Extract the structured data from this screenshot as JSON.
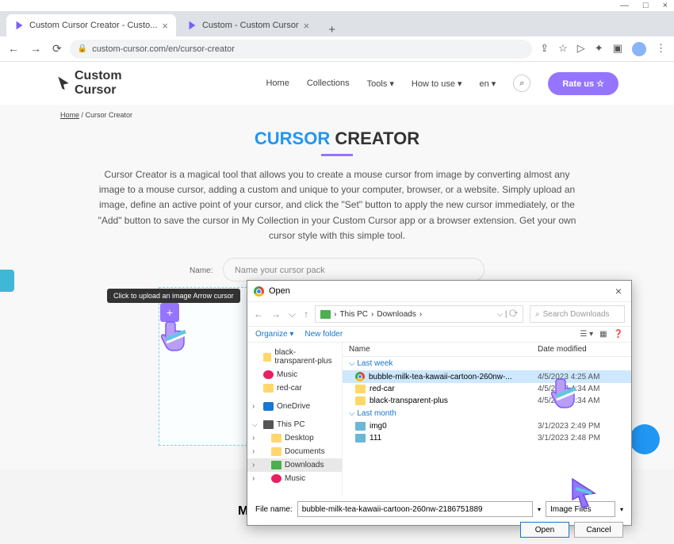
{
  "window": {
    "minimize": "—",
    "maximize": "□",
    "close": "×"
  },
  "tabs": [
    {
      "title": "Custom Cursor Creator - Custo...",
      "active": true
    },
    {
      "title": "Custom - Custom Cursor",
      "active": false
    }
  ],
  "address": {
    "url": "custom-cursor.com/en/cursor-creator"
  },
  "nav": {
    "home": "Home",
    "collections": "Collections",
    "tools": "Tools ▾",
    "how": "How to use ▾",
    "lang": "en ▾",
    "rate": "Rate us ☆"
  },
  "breadcrumb": {
    "home": "Home",
    "sep": " / ",
    "page": "Cursor Creator"
  },
  "heading": {
    "cursor": "CURSOR",
    "creator": " CREATOR"
  },
  "description": "Cursor Creator is a magical tool that allows you to create a mouse cursor from image by converting almost any image to a mouse cursor, adding a custom and unique to your computer, browser, or a website. Simply upload an image, define an active point of your cursor, and click the \"Set\" button to apply the new cursor immediately, or the \"Add\" button to save the cursor in My Collection in your Custom Cursor app or a browser extension. Get your own cursor style with this simple tool.",
  "form": {
    "name_label": "Name:",
    "name_placeholder": "Name your cursor pack"
  },
  "tooltip": "Click to upload an image Arrow cursor",
  "my_section": "MY",
  "dialog": {
    "title": "Open",
    "path": {
      "pc": "This PC",
      "dl": "Downloads"
    },
    "search_placeholder": "Search Downloads",
    "organize": "Organize ▾",
    "newfolder": "New folder",
    "col_name": "Name",
    "col_date": "Date modified",
    "tree": [
      {
        "label": "black-transparent-plus",
        "type": "folder"
      },
      {
        "label": "Music",
        "type": "music"
      },
      {
        "label": "red-car",
        "type": "folder"
      },
      {
        "label": "",
        "type": "spacer"
      },
      {
        "label": "OneDrive",
        "type": "drive",
        "exp": "col"
      },
      {
        "label": "",
        "type": "spacer"
      },
      {
        "label": "This PC",
        "type": "pc",
        "exp": "exp"
      },
      {
        "label": "Desktop",
        "type": "folder",
        "indent": true,
        "exp": "col"
      },
      {
        "label": "Documents",
        "type": "folder",
        "indent": true,
        "exp": "col"
      },
      {
        "label": "Downloads",
        "type": "dl",
        "indent": true,
        "sel": true,
        "exp": "col"
      },
      {
        "label": "Music",
        "type": "music",
        "indent": true,
        "exp": "col"
      }
    ],
    "groups": [
      {
        "label": "⌵ Last week",
        "rows": [
          {
            "name": "bubble-milk-tea-kawaii-cartoon-260nw-...",
            "date": "4/5/2023 4:25 AM",
            "icon": "chrome",
            "sel": true
          },
          {
            "name": "red-car",
            "date": "4/5/2023 4:34 AM",
            "icon": "folder"
          },
          {
            "name": "black-transparent-plus",
            "date": "4/5/2023 4:34 AM",
            "icon": "folder"
          }
        ]
      },
      {
        "label": "⌵ Last month",
        "rows": [
          {
            "name": "img0",
            "date": "3/1/2023 2:49 PM",
            "icon": "img"
          },
          {
            "name": "111",
            "date": "3/1/2023 2:48 PM",
            "icon": "img"
          }
        ]
      }
    ],
    "filename_label": "File name:",
    "filename": "bubble-milk-tea-kawaii-cartoon-260nw-2186751889",
    "filetype": "Image Files",
    "open": "Open",
    "cancel": "Cancel"
  }
}
